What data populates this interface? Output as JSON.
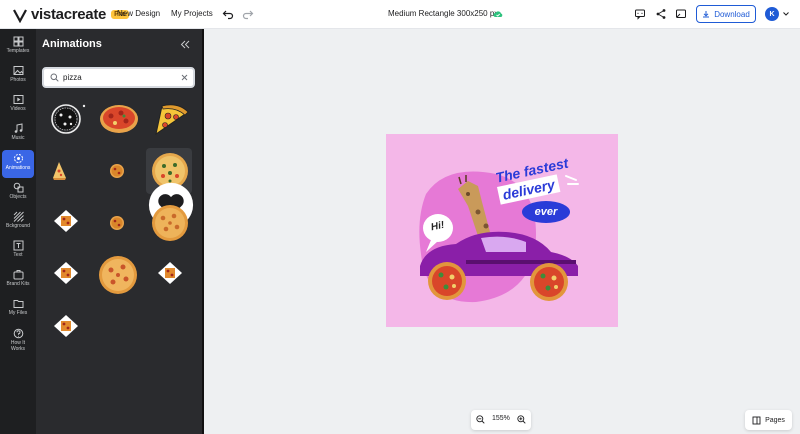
{
  "topbar": {
    "logo_text": "vistacreate",
    "pro_badge": "Pro",
    "nav": [
      "New Design",
      "My Projects"
    ],
    "document_title": "Medium Rectangle 300x250 px",
    "download_label": "Download",
    "avatar_initial": "K"
  },
  "rail": {
    "items": [
      {
        "label": "Templates",
        "icon": "grid-icon"
      },
      {
        "label": "Photos",
        "icon": "image-icon"
      },
      {
        "label": "Videos",
        "icon": "play-icon"
      },
      {
        "label": "Music",
        "icon": "music-note-icon"
      },
      {
        "label": "Animations",
        "icon": "animation-icon",
        "active": true
      },
      {
        "label": "Objects",
        "icon": "shapes-icon"
      },
      {
        "label": "Bckground",
        "icon": "stripes-icon"
      },
      {
        "label": "Text",
        "icon": "text-icon"
      },
      {
        "label": "Brand Kits",
        "icon": "brand-kit-icon"
      },
      {
        "label": "My Files",
        "icon": "folder-icon"
      },
      {
        "label": "How It Works",
        "icon": "help-icon"
      }
    ]
  },
  "panel": {
    "title": "Animations",
    "search_value": "pizza",
    "results": [
      "pizza-sketch",
      "whole-pizza",
      "pizza-slice",
      "small-pizza-slice",
      "mini-pizza",
      "pizza-with-olives",
      "pizza-box-sticker",
      "tiny-pizza",
      "round-pizza",
      "pizza-box-sticker",
      "pepperoni-pizza",
      "pizza-box-sticker",
      "pizza-box-sticker"
    ]
  },
  "canvas": {
    "headline_line1": "The fastest",
    "headline_line2": "delivery",
    "headline_pill": "ever",
    "bubble_text": "Hi!",
    "colors": {
      "background": "#f4b7e8",
      "headline": "#2a3bd8",
      "car": "#8a1fa8"
    }
  },
  "footer": {
    "zoom_value": "155%",
    "pages_label": "Pages"
  },
  "colors": {
    "accent": "#3a66e6",
    "rail_bg": "#1e1f21",
    "panel_bg": "#2a2b2e"
  }
}
